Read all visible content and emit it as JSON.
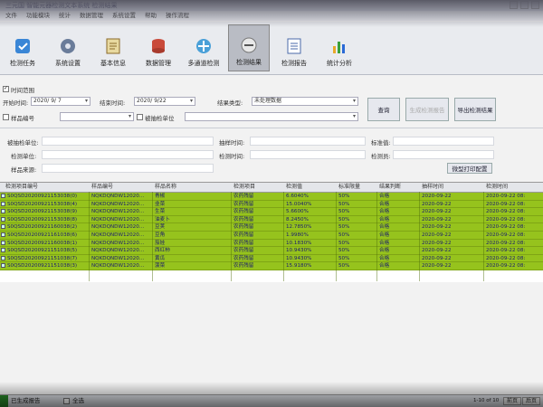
{
  "window": {
    "title": "三元国 智能元器检测文本系统 检测结果"
  },
  "menu": [
    "文件",
    "功能模块",
    "统计",
    "数据管理",
    "系统设置",
    "帮助",
    "操作流程"
  ],
  "toolbar": [
    {
      "label": "检测任务",
      "icon": "task-icon"
    },
    {
      "label": "系统设置",
      "icon": "settings-icon"
    },
    {
      "label": "基本信息",
      "icon": "info-icon"
    },
    {
      "label": "数据管理",
      "icon": "database-icon"
    },
    {
      "label": "多通道检测",
      "icon": "multichannel-icon"
    },
    {
      "label": "检测结果",
      "icon": "result-icon",
      "active": true
    },
    {
      "label": "检测报告",
      "icon": "report-icon"
    },
    {
      "label": "统计分析",
      "icon": "chart-icon"
    }
  ],
  "filters": {
    "time_range_label": "时间范围",
    "time_range_checked": true,
    "start_label": "开始时间:",
    "start_value": "2020/ 9/ 7",
    "end_label": "结束时间:",
    "end_value": "2020/ 9/22",
    "result_type_label": "结果类型:",
    "result_type_value": "未处理数据",
    "sample_code_label": "样品编号",
    "inspected_unit_label": "被抽检单位",
    "query_button": "查询",
    "generate_report_button": "生成检测报告",
    "export_button": "导出检测结果"
  },
  "details": {
    "inspected_unit": "被抽检单位:",
    "sample_time": "抽样时间:",
    "standard": "标准值:",
    "testing_unit": "检测单位:",
    "test_time": "检测时间:",
    "tester": "检测员:",
    "sample_source": "样品来源:",
    "print_config_button": "微型打印配置"
  },
  "table": {
    "headers": [
      "检测项目编号",
      "样品编号",
      "样品名称",
      "检测项目",
      "检测值",
      "标准限量",
      "结果判断",
      "抽样时间",
      "检测时间"
    ],
    "rows": [
      [
        "S0QSD20200921153038(0)",
        "NQKDQNDW12020...",
        "青椒",
        "农药残留",
        "6.6040%",
        "50%",
        "合格",
        "2020-09-22",
        "2020-09-22 08:"
      ],
      [
        "S0QSD20200921153038(4)",
        "NQKDQNDW12020...",
        "韭菜",
        "农药残留",
        "15.0040%",
        "50%",
        "合格",
        "2020-09-22",
        "2020-09-22 08:"
      ],
      [
        "S0QSD20200921153038(9)",
        "NQKDQNDW12020...",
        "生菜",
        "农药残留",
        "5.6600%",
        "50%",
        "合格",
        "2020-09-22",
        "2020-09-22 08:"
      ],
      [
        "S0QSD20200921153038(8)",
        "NQKDQNDW12020...",
        "油麦卜",
        "农药残留",
        "8.2450%",
        "50%",
        "合格",
        "2020-09-22",
        "2020-09-22 08:"
      ],
      [
        "S0QSD20200921160038(2)",
        "NQKDQNDW12020...",
        "豆荚",
        "农药残留",
        "12.7850%",
        "50%",
        "合格",
        "2020-09-22",
        "2020-09-22 08:"
      ],
      [
        "S0QSD20200921161038(6)",
        "NQKDQNDW12020...",
        "豆角",
        "农药残留",
        "1.9980%",
        "50%",
        "合格",
        "2020-09-22",
        "2020-09-22 08:"
      ],
      [
        "S0QSD20200921160038(1)",
        "NQKDQNDW12020...",
        "茄娃",
        "农药残留",
        "10.1830%",
        "50%",
        "合格",
        "2020-09-22",
        "2020-09-22 08:"
      ],
      [
        "S0QSD20200921151038(5)",
        "NQKDQNDW12020...",
        "西红柿",
        "农药残留",
        "10.9430%",
        "50%",
        "合格",
        "2020-09-22",
        "2020-09-22 08:"
      ],
      [
        "S0QSD20200921151038(7)",
        "NQKDQNDW12020...",
        "黄瓜",
        "农药残留",
        "10.9430%",
        "50%",
        "合格",
        "2020-09-22",
        "2020-09-22 08:"
      ],
      [
        "S0QSD20200921151038(3)",
        "NQKDQNDW12020...",
        "菠菜",
        "农药残留",
        "15.9180%",
        "50%",
        "合格",
        "2020-09-22",
        "2020-09-22 08:"
      ]
    ]
  },
  "status": {
    "generated_label": "已生成报告",
    "select_all_label": "全选",
    "page_info": "1-10 of 10",
    "prev": "前页",
    "next": "后页"
  },
  "colors": {
    "row_green": "#96c31d",
    "row_text": "#1b1b6e"
  }
}
